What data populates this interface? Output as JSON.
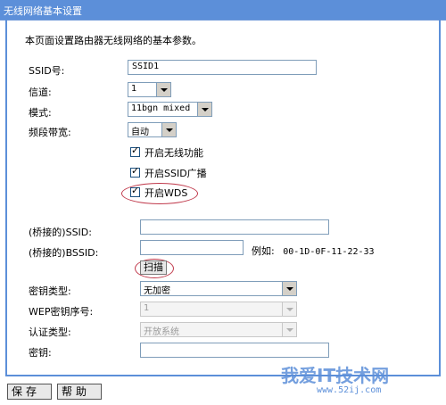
{
  "header": {
    "title": "无线网络基本设置"
  },
  "description": "本页面设置路由器无线网络的基本参数。",
  "fields": {
    "ssid": {
      "label": "SSID号:",
      "value": "SSID1"
    },
    "channel": {
      "label": "信道:",
      "value": "1"
    },
    "mode": {
      "label": "模式:",
      "value": "11bgn mixed"
    },
    "bandwidth": {
      "label": "频段带宽:",
      "value": "自动"
    }
  },
  "checkboxes": {
    "enable_wireless": {
      "label": "开启无线功能",
      "checked": true
    },
    "enable_ssid_broadcast": {
      "label": "开启SSID广播",
      "checked": true
    },
    "enable_wds": {
      "label": "开启WDS",
      "checked": true
    }
  },
  "wds": {
    "bridge_ssid": {
      "label": "(桥接的)SSID:",
      "value": ""
    },
    "bridge_bssid": {
      "label": "(桥接的)BSSID:",
      "value": "",
      "example_label": "例如:",
      "example_value": "00-1D-0F-11-22-33"
    },
    "scan_button": "扫描",
    "key_type": {
      "label": "密钥类型:",
      "value": "无加密"
    },
    "wep_index": {
      "label": "WEP密钥序号:",
      "value": "1"
    },
    "auth_type": {
      "label": "认证类型:",
      "value": "开放系统"
    },
    "key": {
      "label": "密钥:",
      "value": ""
    }
  },
  "footer": {
    "save": "保存",
    "help": "帮助"
  },
  "watermark": {
    "text": "我爱IT技术网",
    "url": "www.52ij.com"
  },
  "colors": {
    "titlebar": "#5c8fd9",
    "frame": "#5c8fd9",
    "highlight": "#c0394b"
  }
}
